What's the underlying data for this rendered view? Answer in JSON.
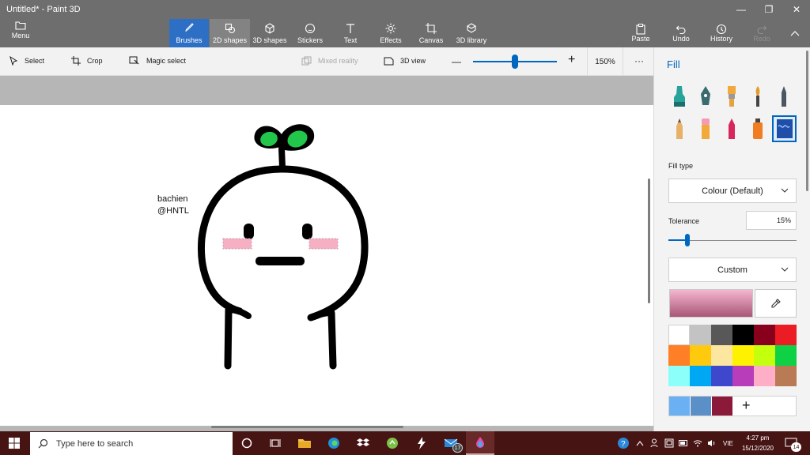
{
  "window": {
    "title": "Untitled* - Paint 3D",
    "minimize": "—",
    "maximize": "❐",
    "close": "✕"
  },
  "menu": {
    "label": "Menu"
  },
  "tools": [
    {
      "label": "Brushes",
      "icon": "brush-icon",
      "active": true
    },
    {
      "label": "2D shapes",
      "icon": "2d-shapes-icon"
    },
    {
      "label": "3D shapes",
      "icon": "3d-shapes-icon"
    },
    {
      "label": "Stickers",
      "icon": "stickers-icon"
    },
    {
      "label": "Text",
      "icon": "text-icon"
    },
    {
      "label": "Effects",
      "icon": "effects-icon"
    },
    {
      "label": "Canvas",
      "icon": "canvas-icon"
    },
    {
      "label": "3D library",
      "icon": "3d-library-icon"
    }
  ],
  "ribbon_right": {
    "paste": "Paste",
    "undo": "Undo",
    "history": "History",
    "redo": "Redo"
  },
  "subtoolbar": {
    "select": "Select",
    "crop": "Crop",
    "magic_select": "Magic select",
    "mixed_reality": "Mixed reality",
    "view_3d": "3D view",
    "zoom_minus": "—",
    "zoom_plus": "+",
    "zoom": "150%",
    "zoom_fraction": 0.5,
    "more": "···"
  },
  "canvas": {
    "signature": "bachien\n@HNTL"
  },
  "panel": {
    "title": "Fill",
    "fill_type_label": "Fill type",
    "fill_type_value": "Colour (Default)",
    "tolerance_label": "Tolerance",
    "tolerance_value": "15%",
    "tolerance_fraction": 0.15,
    "custom_label": "Custom",
    "add": "+",
    "palette": [
      "#ffffff",
      "#c3c3c3",
      "#585858",
      "#000000",
      "#88001b",
      "#ec1c24",
      "#ff7f27",
      "#ffc90e",
      "#fde6a0",
      "#fff200",
      "#c4ff0e",
      "#0ed145",
      "#8cfffb",
      "#00a8f3",
      "#3f48cc",
      "#b83dba",
      "#ffaec8",
      "#b97a56"
    ],
    "custom_colors": [
      "#6ab0f3",
      "#5a8fc8",
      "#8b1a3a"
    ],
    "selected_color": "#f5b6cf"
  },
  "taskbar": {
    "search_placeholder": "Type here to search",
    "mail_badge": "17",
    "language": "VIE",
    "time": "4:27 pm",
    "date": "15/12/2020",
    "notifications": "14"
  }
}
